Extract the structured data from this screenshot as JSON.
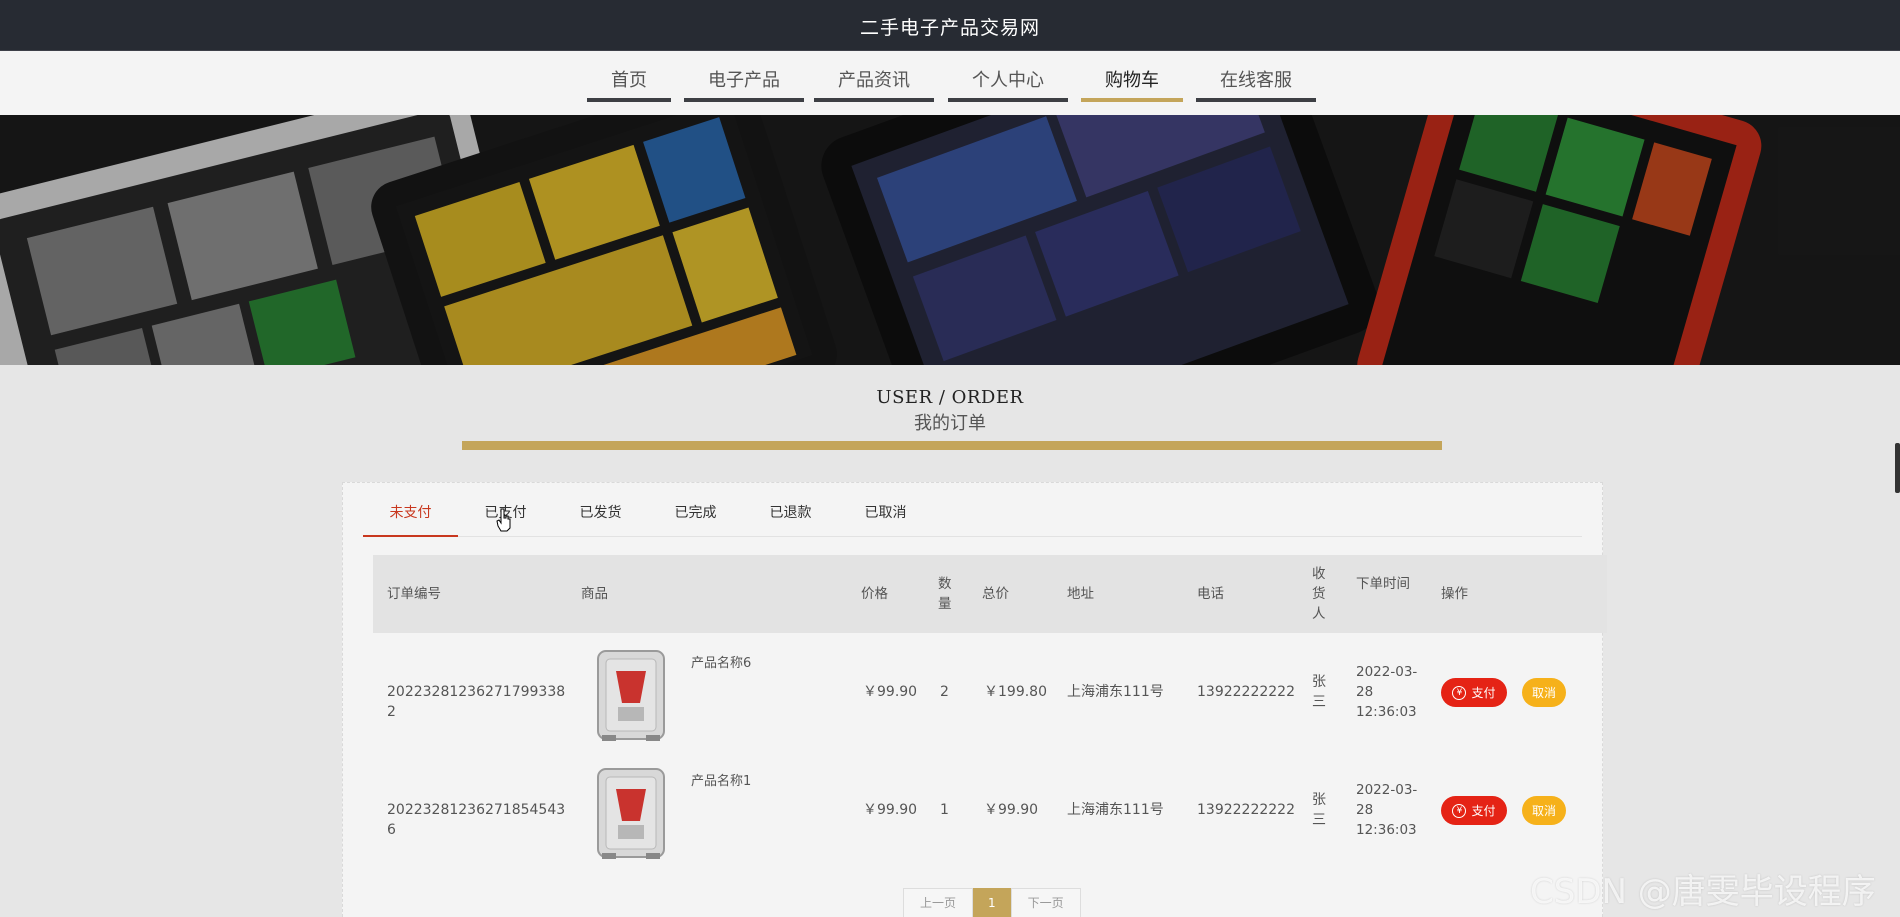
{
  "header": {
    "site_title": "二手电子产品交易网"
  },
  "nav": {
    "items": [
      {
        "label": "首页"
      },
      {
        "label": "电子产品"
      },
      {
        "label": "产品资讯"
      },
      {
        "label": "个人中心"
      },
      {
        "label": "购物车",
        "active": true
      },
      {
        "label": "在线客服"
      }
    ]
  },
  "section": {
    "title_en": "USER / ORDER",
    "title_cn": "我的订单"
  },
  "tabs": [
    {
      "label": "未支付",
      "active": true
    },
    {
      "label": "已支付"
    },
    {
      "label": "已发货"
    },
    {
      "label": "已完成"
    },
    {
      "label": "已退款"
    },
    {
      "label": "已取消"
    }
  ],
  "table": {
    "headers": {
      "order_no": "订单编号",
      "product": "商品",
      "price": "价格",
      "qty": "数量",
      "total": "总价",
      "address": "地址",
      "phone": "电话",
      "receiver": "收货人",
      "time": "下单时间",
      "action": "操作"
    },
    "rows": [
      {
        "order_no": "20223281236271799338 2",
        "product_name": "产品名称6",
        "price": "￥99.90",
        "qty": "2",
        "total": "￥199.80",
        "address": "上海浦东111号",
        "phone": "13922222222",
        "receiver": "张三",
        "time": "2022-03-28 12:36:03"
      },
      {
        "order_no": "20223281236271854543 6",
        "product_name": "产品名称1",
        "price": "￥99.90",
        "qty": "1",
        "total": "￥99.90",
        "address": "上海浦东111号",
        "phone": "13922222222",
        "receiver": "张三",
        "time": "2022-03-28 12:36:03"
      }
    ],
    "pay_label": "支付",
    "cancel_label": "取消",
    "pay_icon_glyph": "¥"
  },
  "pagination": {
    "prev": "上一页",
    "current": "1",
    "next": "下一页"
  },
  "watermark": "CSDN @唐雯毕设程序",
  "colors": {
    "accent": "#c4a55a",
    "active_tab": "#c8371e",
    "pay": "#e52315",
    "cancel": "#f6b11a",
    "topbar": "#272b33"
  }
}
